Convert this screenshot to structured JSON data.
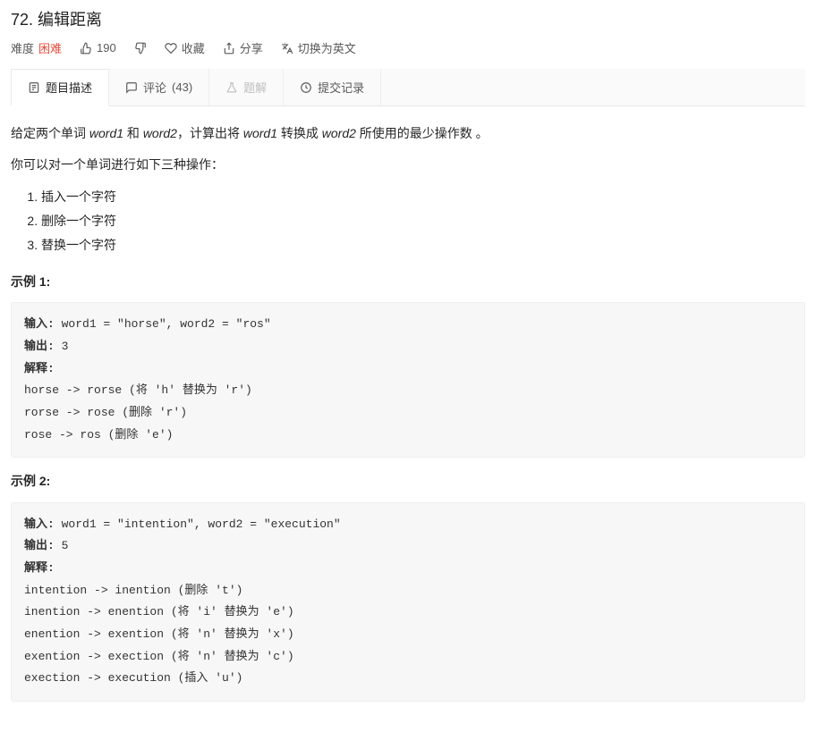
{
  "title": "72. 编辑距离",
  "meta": {
    "difficulty_label": "难度",
    "difficulty_value": "困难",
    "likes": "190",
    "favorite": "收藏",
    "share": "分享",
    "switch_lang": "切换为英文"
  },
  "tabs": {
    "description": "题目描述",
    "comments_label": "评论",
    "comments_count": "(43)",
    "solution": "题解",
    "submissions": "提交记录"
  },
  "body": {
    "para1_a": "给定两个单词 ",
    "para1_w1": "word1",
    "para1_b": " 和 ",
    "para1_w2": "word2",
    "para1_c": "，计算出将 ",
    "para1_w1b": "word1",
    "para1_d": " 转换成 ",
    "para1_w2b": "word2",
    "para1_e": " 所使用的最少操作数 。",
    "para2": "你可以对一个单词进行如下三种操作：",
    "ops": [
      "插入一个字符",
      "删除一个字符",
      "替换一个字符"
    ],
    "ex1_label": "示例 1:",
    "ex1_input_k": "输入: ",
    "ex1_input_v": "word1 = \"horse\", word2 = \"ros\"",
    "ex1_output_k": "输出: ",
    "ex1_output_v": "3",
    "ex1_explain_k": "解释: ",
    "ex1_lines": [
      "horse -> rorse (将 'h' 替换为 'r')",
      "rorse -> rose (删除 'r')",
      "rose -> ros (删除 'e')"
    ],
    "ex2_label": "示例 2:",
    "ex2_input_k": "输入: ",
    "ex2_input_v": "word1 = \"intention\", word2 = \"execution\"",
    "ex2_output_k": "输出: ",
    "ex2_output_v": "5",
    "ex2_explain_k": "解释: ",
    "ex2_lines": [
      "intention -> inention (删除 't')",
      "inention -> enention (将 'i' 替换为 'e')",
      "enention -> exention (将 'n' 替换为 'x')",
      "exention -> exection (将 'n' 替换为 'c')",
      "exection -> execution (插入 'u')"
    ]
  }
}
